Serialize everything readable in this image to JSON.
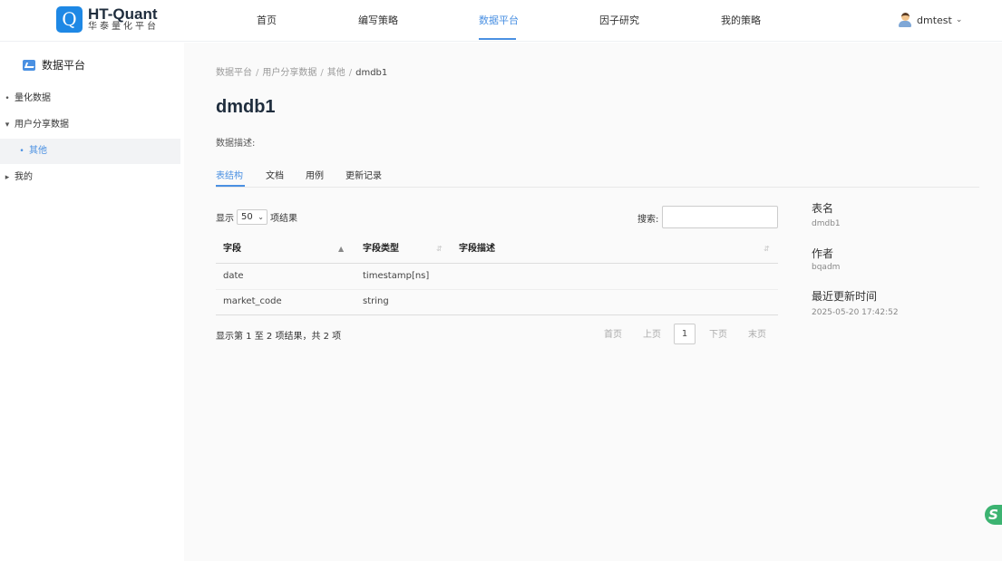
{
  "app": {
    "logo_letter": "Q",
    "title": "HT-Quant",
    "subtitle": "华泰量化平台"
  },
  "nav": {
    "items": [
      {
        "label": "首页"
      },
      {
        "label": "编写策略"
      },
      {
        "label": "数据平台",
        "active": true
      },
      {
        "label": "因子研究"
      },
      {
        "label": "我的策略"
      }
    ],
    "user": {
      "name": "dmtest"
    }
  },
  "sidebar": {
    "title": "数据平台",
    "items": [
      {
        "label": "量化数据",
        "marker": "•"
      },
      {
        "label": "用户分享数据",
        "marker": "▾"
      },
      {
        "label": "其他",
        "marker": "•",
        "selected": true
      },
      {
        "label": "我的",
        "marker": "▸"
      }
    ]
  },
  "breadcrumb": {
    "items": [
      "数据平台",
      "用户分享数据",
      "其他",
      "dmdb1"
    ],
    "separator": "/"
  },
  "page": {
    "title": "dmdb1",
    "description_label": "数据描述:"
  },
  "tabs": [
    {
      "label": "表结构",
      "active": true
    },
    {
      "label": "文档"
    },
    {
      "label": "用例"
    },
    {
      "label": "更新记录"
    }
  ],
  "table_controls": {
    "show_prefix": "显示",
    "page_size": "50",
    "show_suffix": "项结果",
    "search_label": "搜索:",
    "search_value": ""
  },
  "table": {
    "columns": [
      "字段",
      "字段类型",
      "字段描述"
    ],
    "rows": [
      {
        "field": "date",
        "type": "timestamp[ns]",
        "desc": ""
      },
      {
        "field": "market_code",
        "type": "string",
        "desc": ""
      }
    ]
  },
  "pagination": {
    "info": "显示第 1 至 2 项结果，共 2 项",
    "first": "首页",
    "prev": "上页",
    "current": "1",
    "next": "下页",
    "last": "末页"
  },
  "meta": {
    "table_name_label": "表名",
    "table_name": "dmdb1",
    "author_label": "作者",
    "author": "bqadm",
    "updated_label": "最近更新时间",
    "updated": "2025-05-20 17:42:52"
  },
  "colors": {
    "accent": "#4a90e2",
    "brand": "#1e88e5",
    "float_button": "#3cb371"
  },
  "icons": {
    "sidebar_header": "chart-icon",
    "user": "avatar-icon",
    "float": "assistant-icon"
  }
}
